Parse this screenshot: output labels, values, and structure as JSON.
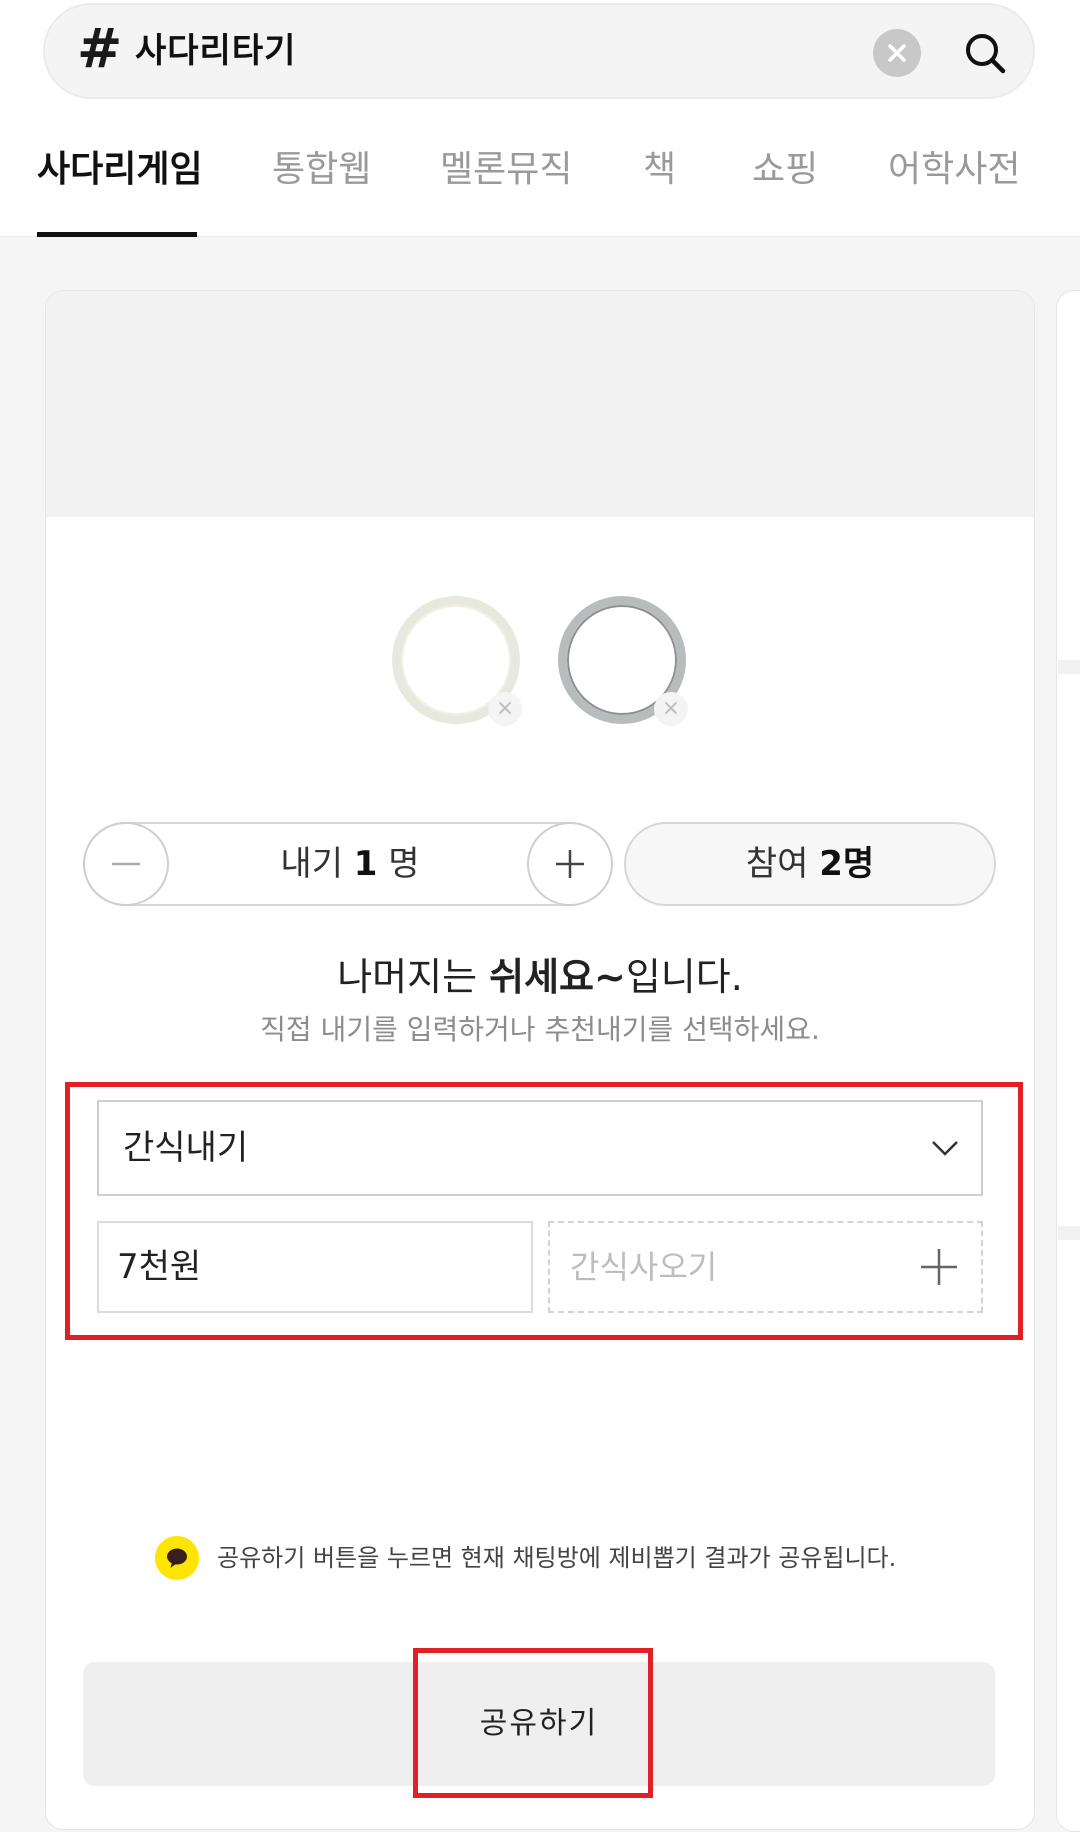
{
  "search": {
    "hash": "#",
    "query": "사다리타기"
  },
  "tabs": [
    {
      "label": "사다리게임",
      "active": true
    },
    {
      "label": "통합웹"
    },
    {
      "label": "멜론뮤직"
    },
    {
      "label": "책"
    },
    {
      "label": "쇼핑"
    },
    {
      "label": "어학사전"
    }
  ],
  "game": {
    "avatars": [
      {
        "remove": "×"
      },
      {
        "remove": "×"
      }
    ],
    "count": {
      "label": "내기",
      "value": "1",
      "unit": "명"
    },
    "join": {
      "label": "참여",
      "value": "2명"
    },
    "result": {
      "prefix": "나머지는 ",
      "highlight": "쉬세요~",
      "suffix": "입니다."
    },
    "hint": "직접 내기를 입력하거나 추천내기를 선택하세요.",
    "select": {
      "value": "간식내기"
    },
    "amount": "7천원",
    "add_placeholder": "간식사오기",
    "notice": "공유하기 버튼을 누르면 현재 채팅방에 제비뽑기 결과가 공유됩니다.",
    "share_label": "공유하기"
  },
  "colors": {
    "highlight": "#e02025",
    "kakao": "#fee500"
  }
}
